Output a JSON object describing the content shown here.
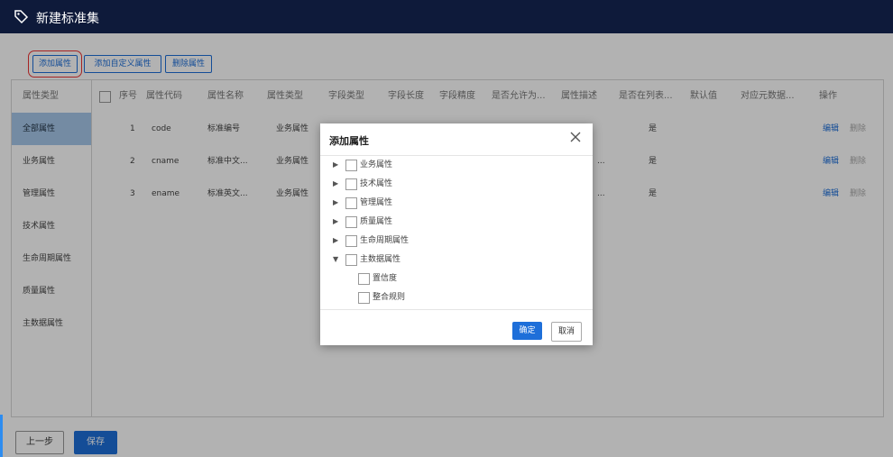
{
  "window": {
    "title": "新建标准集",
    "icon": "tag-icon"
  },
  "toolbar": {
    "add_attr": "添加属性",
    "add_custom_attr": "添加自定义属性",
    "delete_attr": "删除属性"
  },
  "sidebar": {
    "header": "属性类型",
    "items": [
      {
        "label": "全部属性",
        "active": true
      },
      {
        "label": "业务属性"
      },
      {
        "label": "管理属性"
      },
      {
        "label": "技术属性"
      },
      {
        "label": "生命周期属性"
      },
      {
        "label": "质量属性"
      },
      {
        "label": "主数据属性"
      }
    ]
  },
  "table": {
    "columns": [
      "序号",
      "属性代码",
      "属性名称",
      "属性类型",
      "字段类型",
      "字段长度",
      "字段精度",
      "是否允许为...",
      "属性描述",
      "是否在列表...",
      "默认值",
      "对应元数据...",
      "操作"
    ],
    "rows": [
      {
        "index": "1",
        "code": "code",
        "name": "标准编号",
        "type": "业务属性",
        "desc_tail": "",
        "in_list": "是",
        "edit": "编辑",
        "delete": "删除"
      },
      {
        "index": "2",
        "code": "cname",
        "name": "标准中文...",
        "type": "业务属性",
        "desc_tail": "...",
        "in_list": "是",
        "edit": "编辑",
        "delete": "删除"
      },
      {
        "index": "3",
        "code": "ename",
        "name": "标准英文...",
        "type": "业务属性",
        "desc_tail": "...",
        "in_list": "是",
        "edit": "编辑",
        "delete": "删除"
      }
    ]
  },
  "footer": {
    "prev": "上一步",
    "save": "保存"
  },
  "modal": {
    "title": "添加属性",
    "tree": [
      {
        "label": "业务属性",
        "expanded": false
      },
      {
        "label": "技术属性",
        "expanded": false
      },
      {
        "label": "管理属性",
        "expanded": false
      },
      {
        "label": "质量属性",
        "expanded": false
      },
      {
        "label": "生命周期属性",
        "expanded": false
      },
      {
        "label": "主数据属性",
        "expanded": true,
        "children": [
          {
            "label": "置信度"
          },
          {
            "label": "整合规则"
          }
        ]
      }
    ],
    "ok": "确定",
    "cancel": "取消"
  },
  "colors": {
    "header_bg": "#0e1a3a",
    "accent": "#1e6fd9",
    "active_row": "#a7c7ea",
    "highlight_outline": "#ee3333"
  }
}
